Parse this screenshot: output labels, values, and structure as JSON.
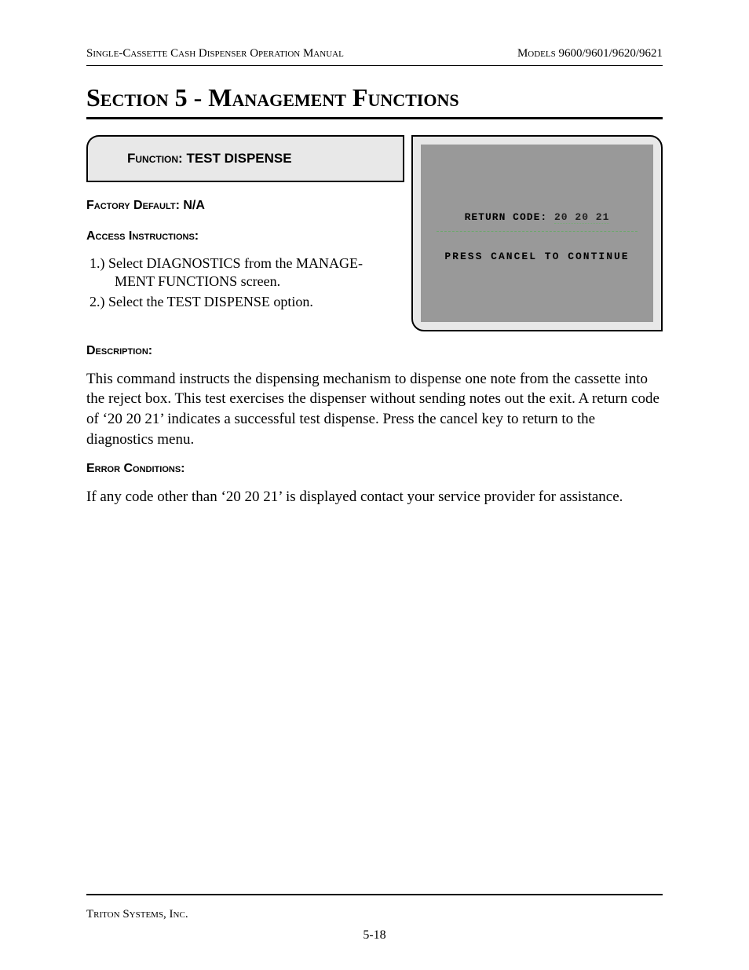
{
  "header": {
    "left": "Single-Cassette Cash Dispenser Operation Manual",
    "right": "Models 9600/9601/9620/9621"
  },
  "section_title": "Section 5 - Management Functions",
  "function": {
    "label_prefix": "Function: ",
    "name": "TEST DISPENSE",
    "factory_default_label": "Factory Default: ",
    "factory_default_value": "N/A",
    "access_label": "Access Instructions:",
    "steps": [
      "1.)  Select DIAGNOSTICS from the MANAGE­MENT FUNCTIONS screen.",
      "2.)  Select the TEST DISPENSE  option."
    ]
  },
  "screen": {
    "return_code_label": "RETURN CODE:",
    "return_code_value": " 20 20 21 ",
    "continue": "PRESS CANCEL TO CONTINUE"
  },
  "description": {
    "label": "Description:",
    "text": "This command instructs the dispensing mechanism to dispense one note from the cassette into the reject box.  This test exercises the dispenser without sending notes out the exit.  A return code of ‘20 20 21’  indicates a successful test dispense. Press the cancel key to return to the diagnostics menu."
  },
  "error": {
    "label": "Error Conditions:",
    "text": "If any code other than ‘20 20 21’ is displayed contact your service provider for assistance."
  },
  "footer": {
    "company": "Triton Systems, Inc.",
    "page": "5-18"
  }
}
